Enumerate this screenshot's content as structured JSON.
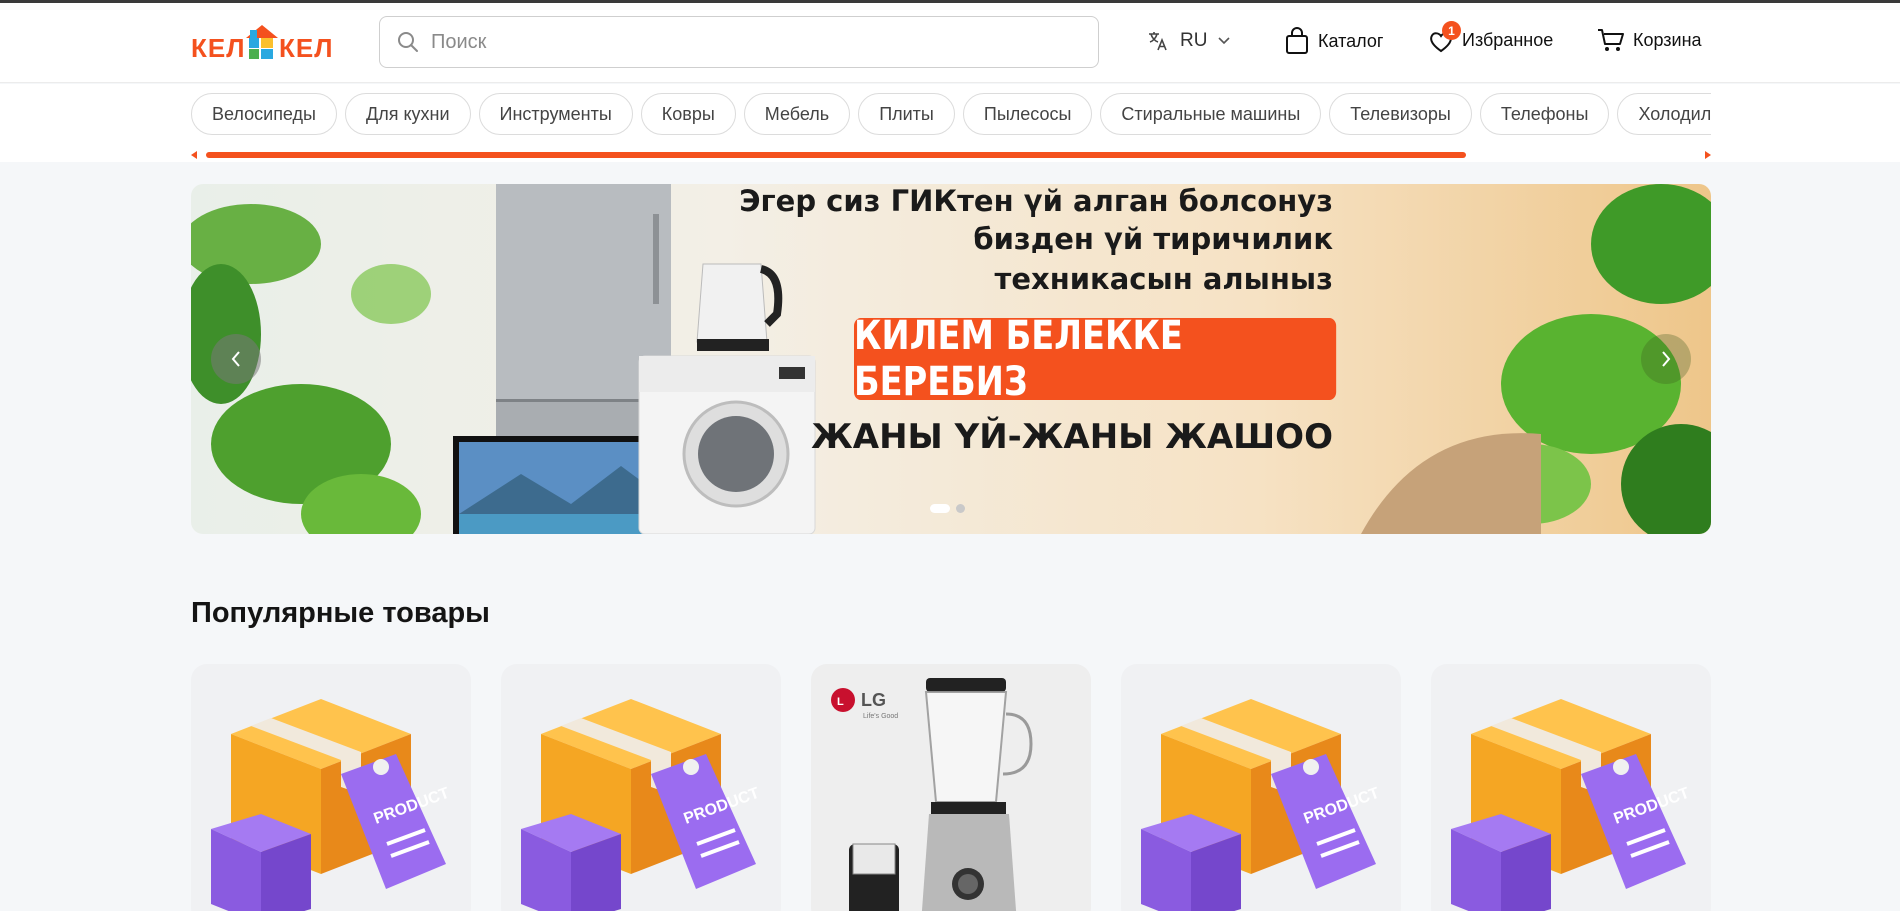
{
  "header": {
    "logo_text": "КЕЛ КЕЛ",
    "search_placeholder": "Поиск",
    "language": "RU",
    "catalog_label": "Каталог",
    "favorites_label": "Избранное",
    "favorites_count": "1",
    "cart_label": "Корзина"
  },
  "categories": [
    "Велосипеды",
    "Для кухни",
    "Инструменты",
    "Ковры",
    "Мебель",
    "Плиты",
    "Пылесосы",
    "Стиральные машины",
    "Телевизоры",
    "Телефоны",
    "Холодильники"
  ],
  "banner": {
    "line1": "Эгер сиз ГИКтен үй алган болсонуз",
    "line2": "бизден үй тиричилик",
    "line3": "техникасын алыныз",
    "promo": "КИЛЕМ БЕЛЕККЕ БЕРЕБИЗ",
    "slogan": "ЖАНЫ ҮЙ-ЖАНЫ ЖАШОО",
    "slide_count": 2,
    "active_slide": 1
  },
  "popular": {
    "title": "Популярные товары",
    "products": [
      {
        "image": "product-box-illustration"
      },
      {
        "image": "product-box-illustration"
      },
      {
        "image": "lg-blender-photo",
        "brand_text": "LG",
        "brand_tagline": "Life's Good"
      },
      {
        "image": "product-box-illustration"
      },
      {
        "image": "product-box-illustration"
      }
    ]
  },
  "colors": {
    "accent": "#f4511e",
    "logo_blue": "#29a8e0",
    "logo_green": "#4caf50",
    "logo_yellow": "#fbc02d"
  }
}
